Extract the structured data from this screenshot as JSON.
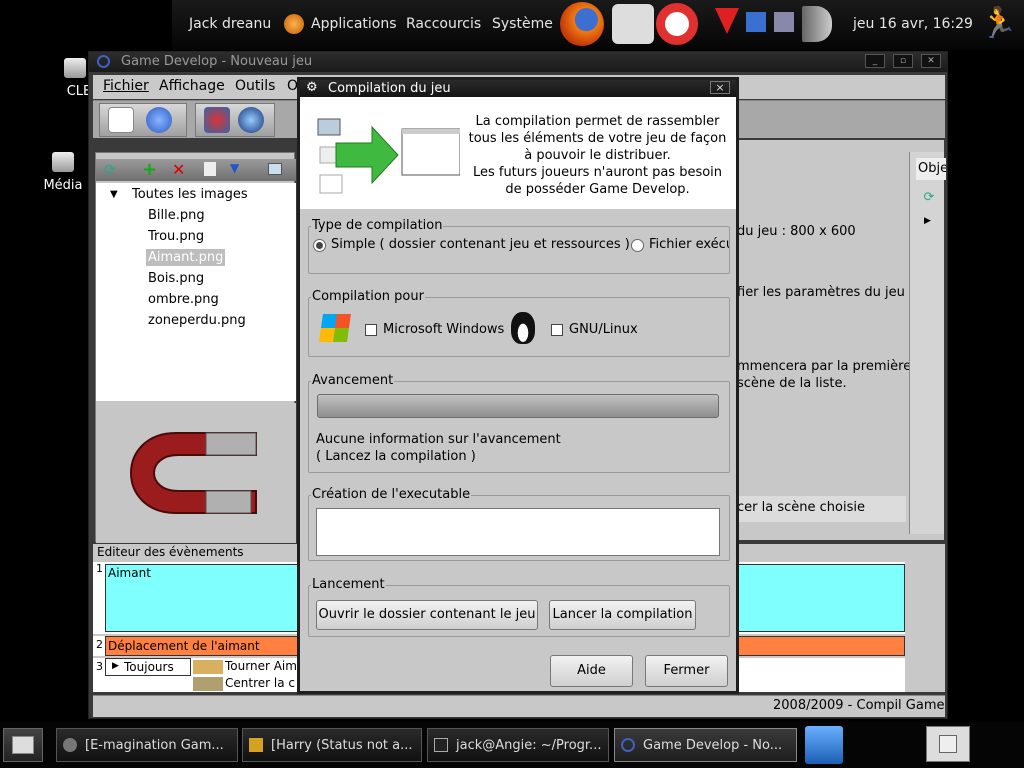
{
  "top_panel": {
    "user": "Jack dreanu",
    "menus": [
      "Applications",
      "Raccourcis",
      "Système"
    ],
    "clock": "jeu 16 avr, 16:29"
  },
  "desktop_icons": [
    "CLE",
    "Média"
  ],
  "main_window": {
    "title": "Game Develop - Nouveau jeu",
    "menu": [
      "Fichier",
      "Affichage",
      "Outils",
      "O"
    ],
    "tree_root": "Toutes les images",
    "images": [
      "Bille.png",
      "Trou.png",
      "Aimant.png",
      "Bois.png",
      "ombre.png",
      "zoneperdu.png"
    ],
    "selected_image": "Aimant.png",
    "right_texts": [
      "du jeu : 800 x 600",
      "fier les paramètres du jeu",
      "mmencera par la première",
      "scène de la liste.",
      "cer la scène choisie"
    ],
    "side_tab": "Obje",
    "events_title": "Editeur des évènements",
    "events": [
      {
        "num": "1",
        "label": "Aimant"
      },
      {
        "num": "2",
        "label": "Déplacement de l'aimant"
      },
      {
        "num": "3",
        "label": "Toujours"
      }
    ],
    "event_actions": [
      "Tourner Aim",
      "Centrer la c"
    ],
    "status": "2008/2009 - Compil Game"
  },
  "dialog": {
    "title": "Compilation du jeu",
    "banner_text": [
      "La compilation permet de rassembler",
      "tous les éléments de votre jeu de façon",
      "à pouvoir le distribuer.",
      "Les futurs joueurs n'auront pas besoin",
      "de posséder Game Develop."
    ],
    "type_legend": "Type de compilation",
    "type_simple": "Simple ( dossier contenant jeu et ressources )",
    "type_file": "Fichier exécut",
    "target_legend": "Compilation pour",
    "target_windows": "Microsoft Windows",
    "target_linux": "GNU/Linux",
    "progress_legend": "Avancement",
    "progress_value": 0,
    "progress_info": [
      "Aucune information sur l'avancement",
      "( Lancez la compilation )"
    ],
    "exec_legend": "Création de l'executable",
    "exec_value": "",
    "launch_legend": "Lancement",
    "open_folder_button": "Ouvrir le dossier contenant le jeu",
    "compile_button": "Lancer la compilation",
    "help_button": "Aide",
    "close_button": "Fermer",
    "close_x": "×"
  },
  "taskbar": {
    "tasks": [
      "[E-magination Gam...",
      "[Harry (Status not a...",
      "jack@Angie: ~/Progr...",
      "Game Develop - No..."
    ],
    "active_task": 3
  }
}
